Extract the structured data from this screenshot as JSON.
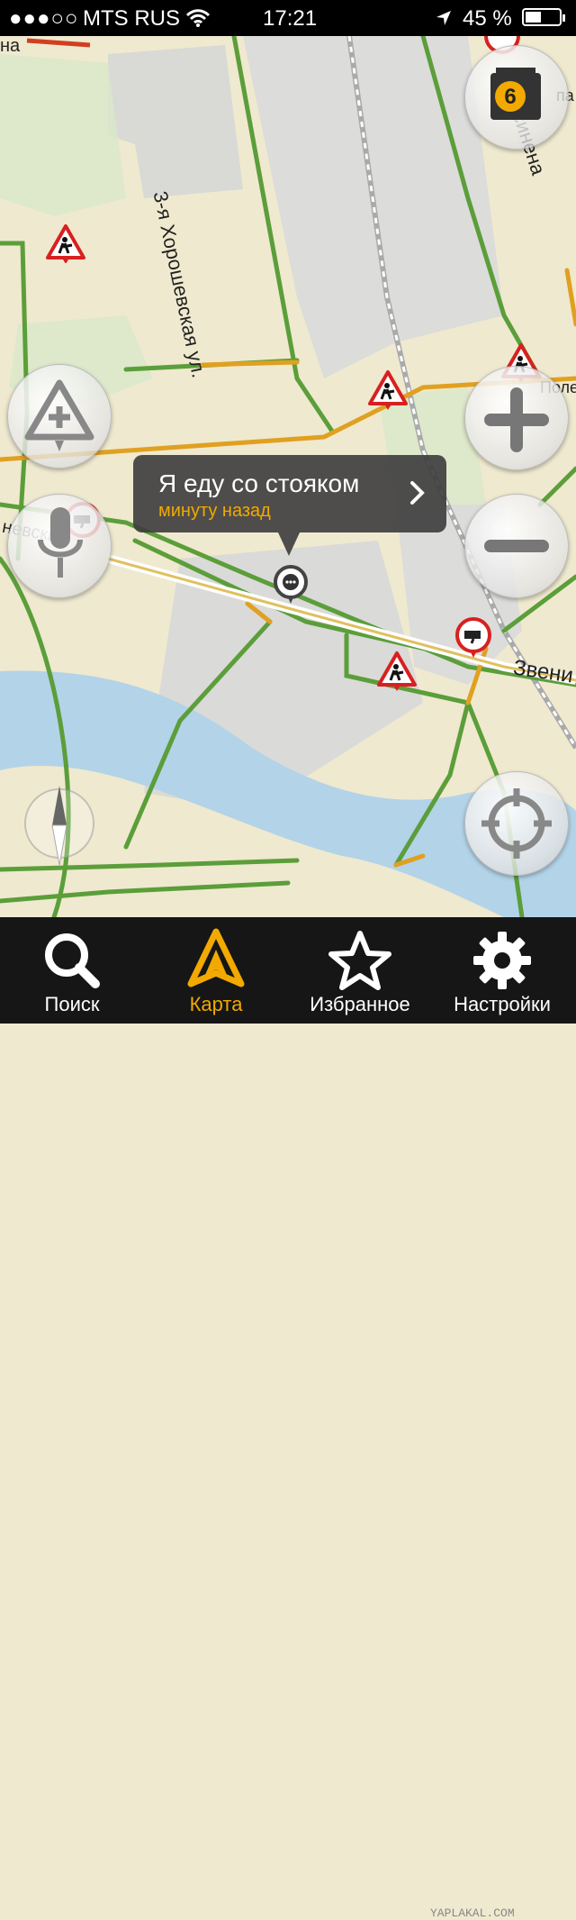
{
  "status_bar": {
    "signal": "●●●○○",
    "carrier": "MTS RUS",
    "time": "17:21",
    "battery": "45 %"
  },
  "map": {
    "labels": {
      "street_khoroshevskaya": "3-я Хорошевская ул.",
      "street_kusinena": "Куусинена",
      "street_zvenigorodskoe": "Звени",
      "street_polezhaevskaya": "Поле",
      "street_khoroshevskaya_2": "невский",
      "top_left": "на",
      "top_right": "па"
    },
    "traffic_level": "6"
  },
  "callout": {
    "title": "Я еду со стояком",
    "subtitle": "минуту назад"
  },
  "tabs": [
    {
      "label": "Поиск",
      "icon": "search-icon",
      "active": false
    },
    {
      "label": "Карта",
      "icon": "map-arrow-icon",
      "active": true
    },
    {
      "label": "Избранное",
      "icon": "star-icon",
      "active": false
    },
    {
      "label": "Настройки",
      "icon": "gear-icon",
      "active": false
    }
  ],
  "watermark": "YAPLAKAL.COM",
  "colors": {
    "accent": "#f2a900",
    "road_green": "#5b9e3a",
    "road_orange": "#e0a020",
    "water": "#b3d3e8",
    "land": "#efe9cf"
  }
}
